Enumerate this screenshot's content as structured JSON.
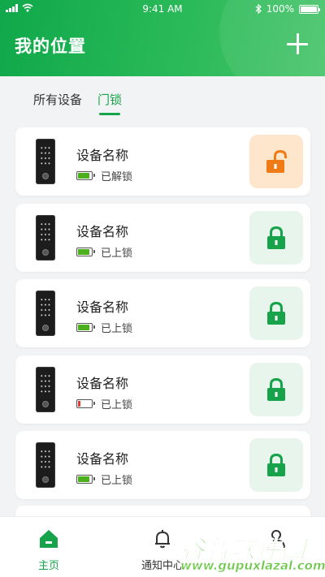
{
  "status_bar": {
    "time": "9:41 AM",
    "battery": "100%"
  },
  "header": {
    "title": "我的位置"
  },
  "tabs": [
    {
      "label": "所有设备",
      "active": false
    },
    {
      "label": "门锁",
      "active": true
    }
  ],
  "devices": [
    {
      "name": "设备名称",
      "status": "已解锁",
      "battery_level": 0.85,
      "battery_color": "#4caf1e",
      "locked": false
    },
    {
      "name": "设备名称",
      "status": "已上锁",
      "battery_level": 0.85,
      "battery_color": "#4caf1e",
      "locked": true
    },
    {
      "name": "设备名称",
      "status": "已上锁",
      "battery_level": 0.85,
      "battery_color": "#4caf1e",
      "locked": true
    },
    {
      "name": "设备名称",
      "status": "已上锁",
      "battery_level": 0.2,
      "battery_color": "#e53935",
      "locked": true
    },
    {
      "name": "设备名称",
      "status": "已上锁",
      "battery_level": 0.85,
      "battery_color": "#4caf1e",
      "locked": true
    }
  ],
  "bottom_nav": [
    {
      "label": "主页",
      "icon": "home-icon",
      "active": true
    },
    {
      "label": "通知中心",
      "icon": "bell-icon",
      "active": false
    },
    {
      "label": "",
      "icon": "person-icon",
      "active": false
    }
  ],
  "watermark": {
    "title": "谷普软件园",
    "url": "www.gupuxlazal.com"
  },
  "colors": {
    "primary": "#16a34a",
    "locked_bg": "#e7f5ec",
    "unlocked_bg": "#fde6cc",
    "unlocked_icon": "#f07a14"
  }
}
